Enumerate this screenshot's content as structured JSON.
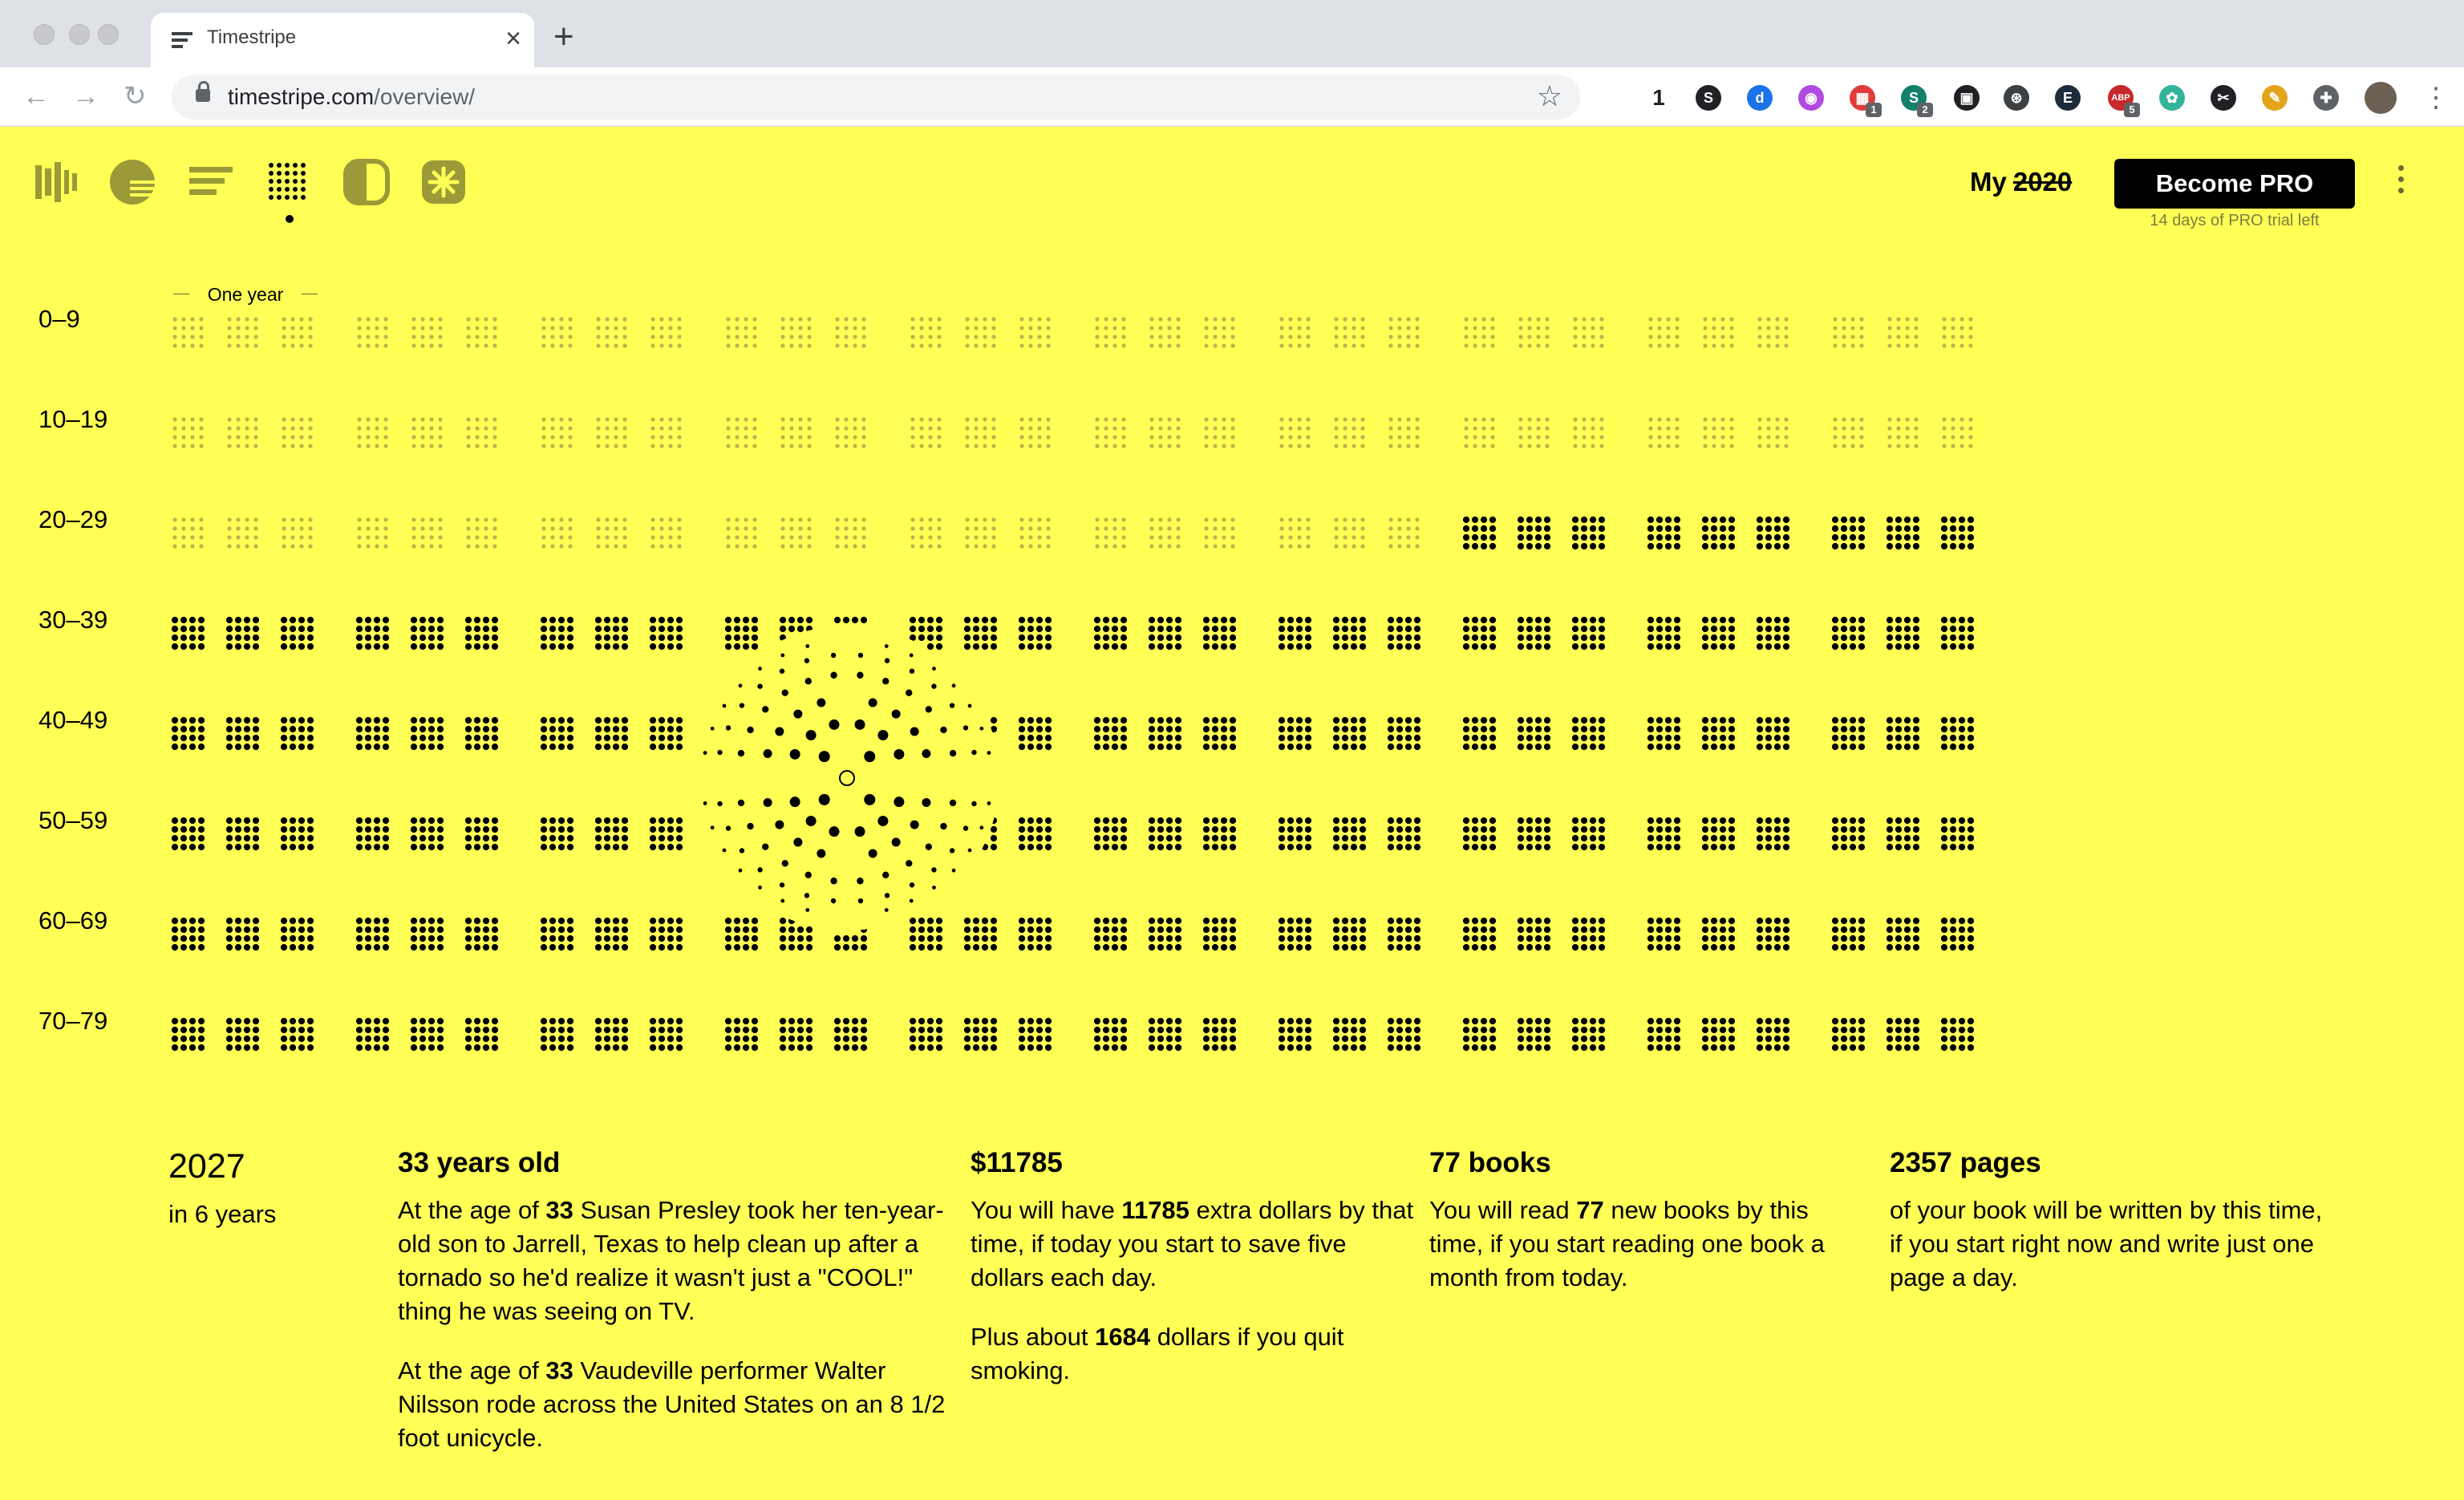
{
  "browser": {
    "tab_title": "Timestripe",
    "url_host": "timestripe.com",
    "url_path": "/overview/",
    "extensions": [
      {
        "name": "counter-extension",
        "label": "1",
        "color": "#ffffff"
      },
      {
        "name": "s-extension",
        "label": "S",
        "color": "#202124"
      },
      {
        "name": "d-extension",
        "label": "d",
        "color": "#1a73e8"
      },
      {
        "name": "power-extension",
        "label": "◉",
        "color": "#b04ae0"
      },
      {
        "name": "calendar-extension",
        "label": "▦",
        "color": "#e23b3b",
        "badge": "1"
      },
      {
        "name": "s2-extension",
        "label": "S",
        "color": "#12806a",
        "badge": "2"
      },
      {
        "name": "media-extension",
        "label": "▣",
        "color": "#202124"
      },
      {
        "name": "chrome-extension",
        "label": "⊛",
        "color": "#3c4043"
      },
      {
        "name": "e-extension",
        "label": "E",
        "color": "#1d2b3a"
      },
      {
        "name": "adblock-extension",
        "label": "ABP",
        "color": "#c8282a",
        "badge": "5"
      },
      {
        "name": "brain-extension",
        "label": "✿",
        "color": "#33b49a"
      },
      {
        "name": "scissors-extension",
        "label": "✂",
        "color": "#202124"
      },
      {
        "name": "pencil-extension",
        "label": "✎",
        "color": "#e3a31a"
      },
      {
        "name": "puzzle-extension",
        "label": "✚",
        "color": "#5f6368"
      }
    ]
  },
  "header": {
    "active_mode": "grid",
    "my_prefix": "My",
    "my_year": "2020",
    "pro_button": "Become PRO",
    "trial_note": "14 days of PRO trial left"
  },
  "grid": {
    "caption": "One year",
    "decades": [
      "0–9",
      "10–19",
      "20–29",
      "30–39",
      "40–49",
      "50–59",
      "60–69",
      "70–79"
    ],
    "lived_until_age": 27.2,
    "magnifier_age": 33
  },
  "facts": {
    "year": "2027",
    "in_years": "in 6 years",
    "age_title": "33 years old",
    "age_p1": [
      "At the age of ",
      "33",
      " Susan Presley took her ten-year-old son to Jarrell, Texas to help clean up after a tornado so he'd realize it wasn't just a \"COOL!\" thing he was seeing on TV."
    ],
    "age_p2": [
      "At the age of ",
      "33",
      " Vaudeville performer Walter Nilsson rode across the United States on an 8 1/2 foot unicycle."
    ],
    "money_title": "$11785",
    "money_p1": [
      "You will have ",
      "11785",
      " extra dollars by that time, if today you start to save five dollars each day."
    ],
    "money_p2": [
      "Plus about ",
      "1684",
      " dollars if you quit smoking."
    ],
    "books_title": "77 books",
    "books_p1": [
      "You will read ",
      "77",
      " new books by this time, if you start reading one book a month from today."
    ],
    "pages_title": "2357 pages",
    "pages_p1": "of your book will be written by this time, if you start right now and write just one page a day."
  }
}
